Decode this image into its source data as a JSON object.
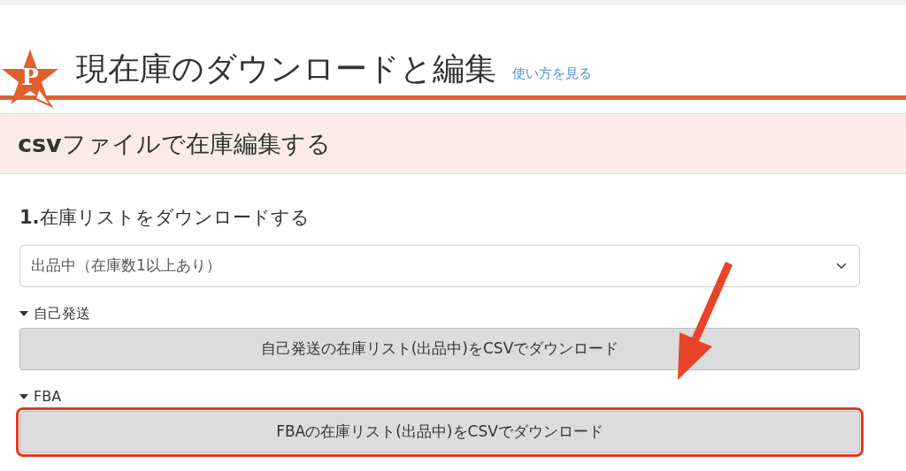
{
  "header": {
    "logo_letter": "P",
    "title": "現在庫のダウンロードと編集",
    "help_link": "使い方を見る"
  },
  "banner": {
    "text": "**csv**ファイルで在庫編集する"
  },
  "step": {
    "number": "1.",
    "title": "在庫リストをダウンロードする"
  },
  "status_select": {
    "value": "出品中（在庫数1以上あり）"
  },
  "sections": [
    {
      "label": "自己発送",
      "expanded": true,
      "button": "自己発送の在庫リスト(出品中)をCSVでダウンロード",
      "highlighted": false
    },
    {
      "label": "FBA",
      "expanded": true,
      "button": "FBAの在庫リスト(出品中)をCSVでダウンロード",
      "highlighted": true
    }
  ]
}
